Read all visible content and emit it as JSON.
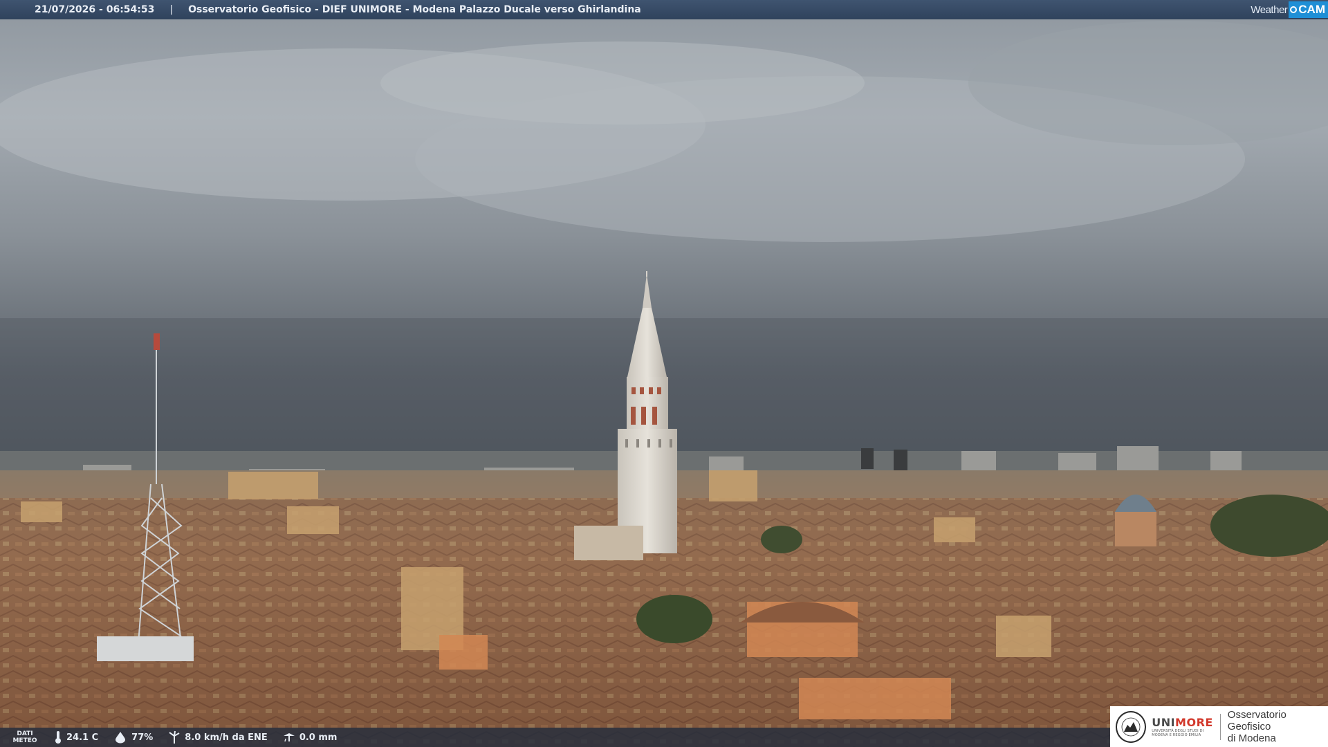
{
  "header": {
    "timestamp": "21/07/2026 - 06:54:53",
    "separator": "|",
    "location_title": "Osservatorio Geofisico - DIEF UNIMORE - Modena Palazzo Ducale verso Ghirlandina"
  },
  "brand": {
    "weather_text": "Weather",
    "cam_text": "CAM",
    "accent_color": "#1f8fd6"
  },
  "meteo": {
    "label_line1": "DATI",
    "label_line2": "METEO",
    "temperature": "24.1 C",
    "humidity": "77%",
    "wind": "8.0 km/h da ENE",
    "rain": "0.0 mm"
  },
  "logo": {
    "uni_part": "UNI",
    "more_part": "MORE",
    "university_line1": "UNIVERSITÀ DEGLI STUDI DI",
    "university_line2": "MODENA E REGGIO EMILIA",
    "observatory_line1": "Osservatorio Geofisico",
    "observatory_line2": "di Modena",
    "brand_color": "#d2382b"
  },
  "icons": {
    "temperature": "thermometer-icon",
    "humidity": "droplet-icon",
    "wind": "wind-turbine-icon",
    "rain": "rain-gauge-icon"
  }
}
